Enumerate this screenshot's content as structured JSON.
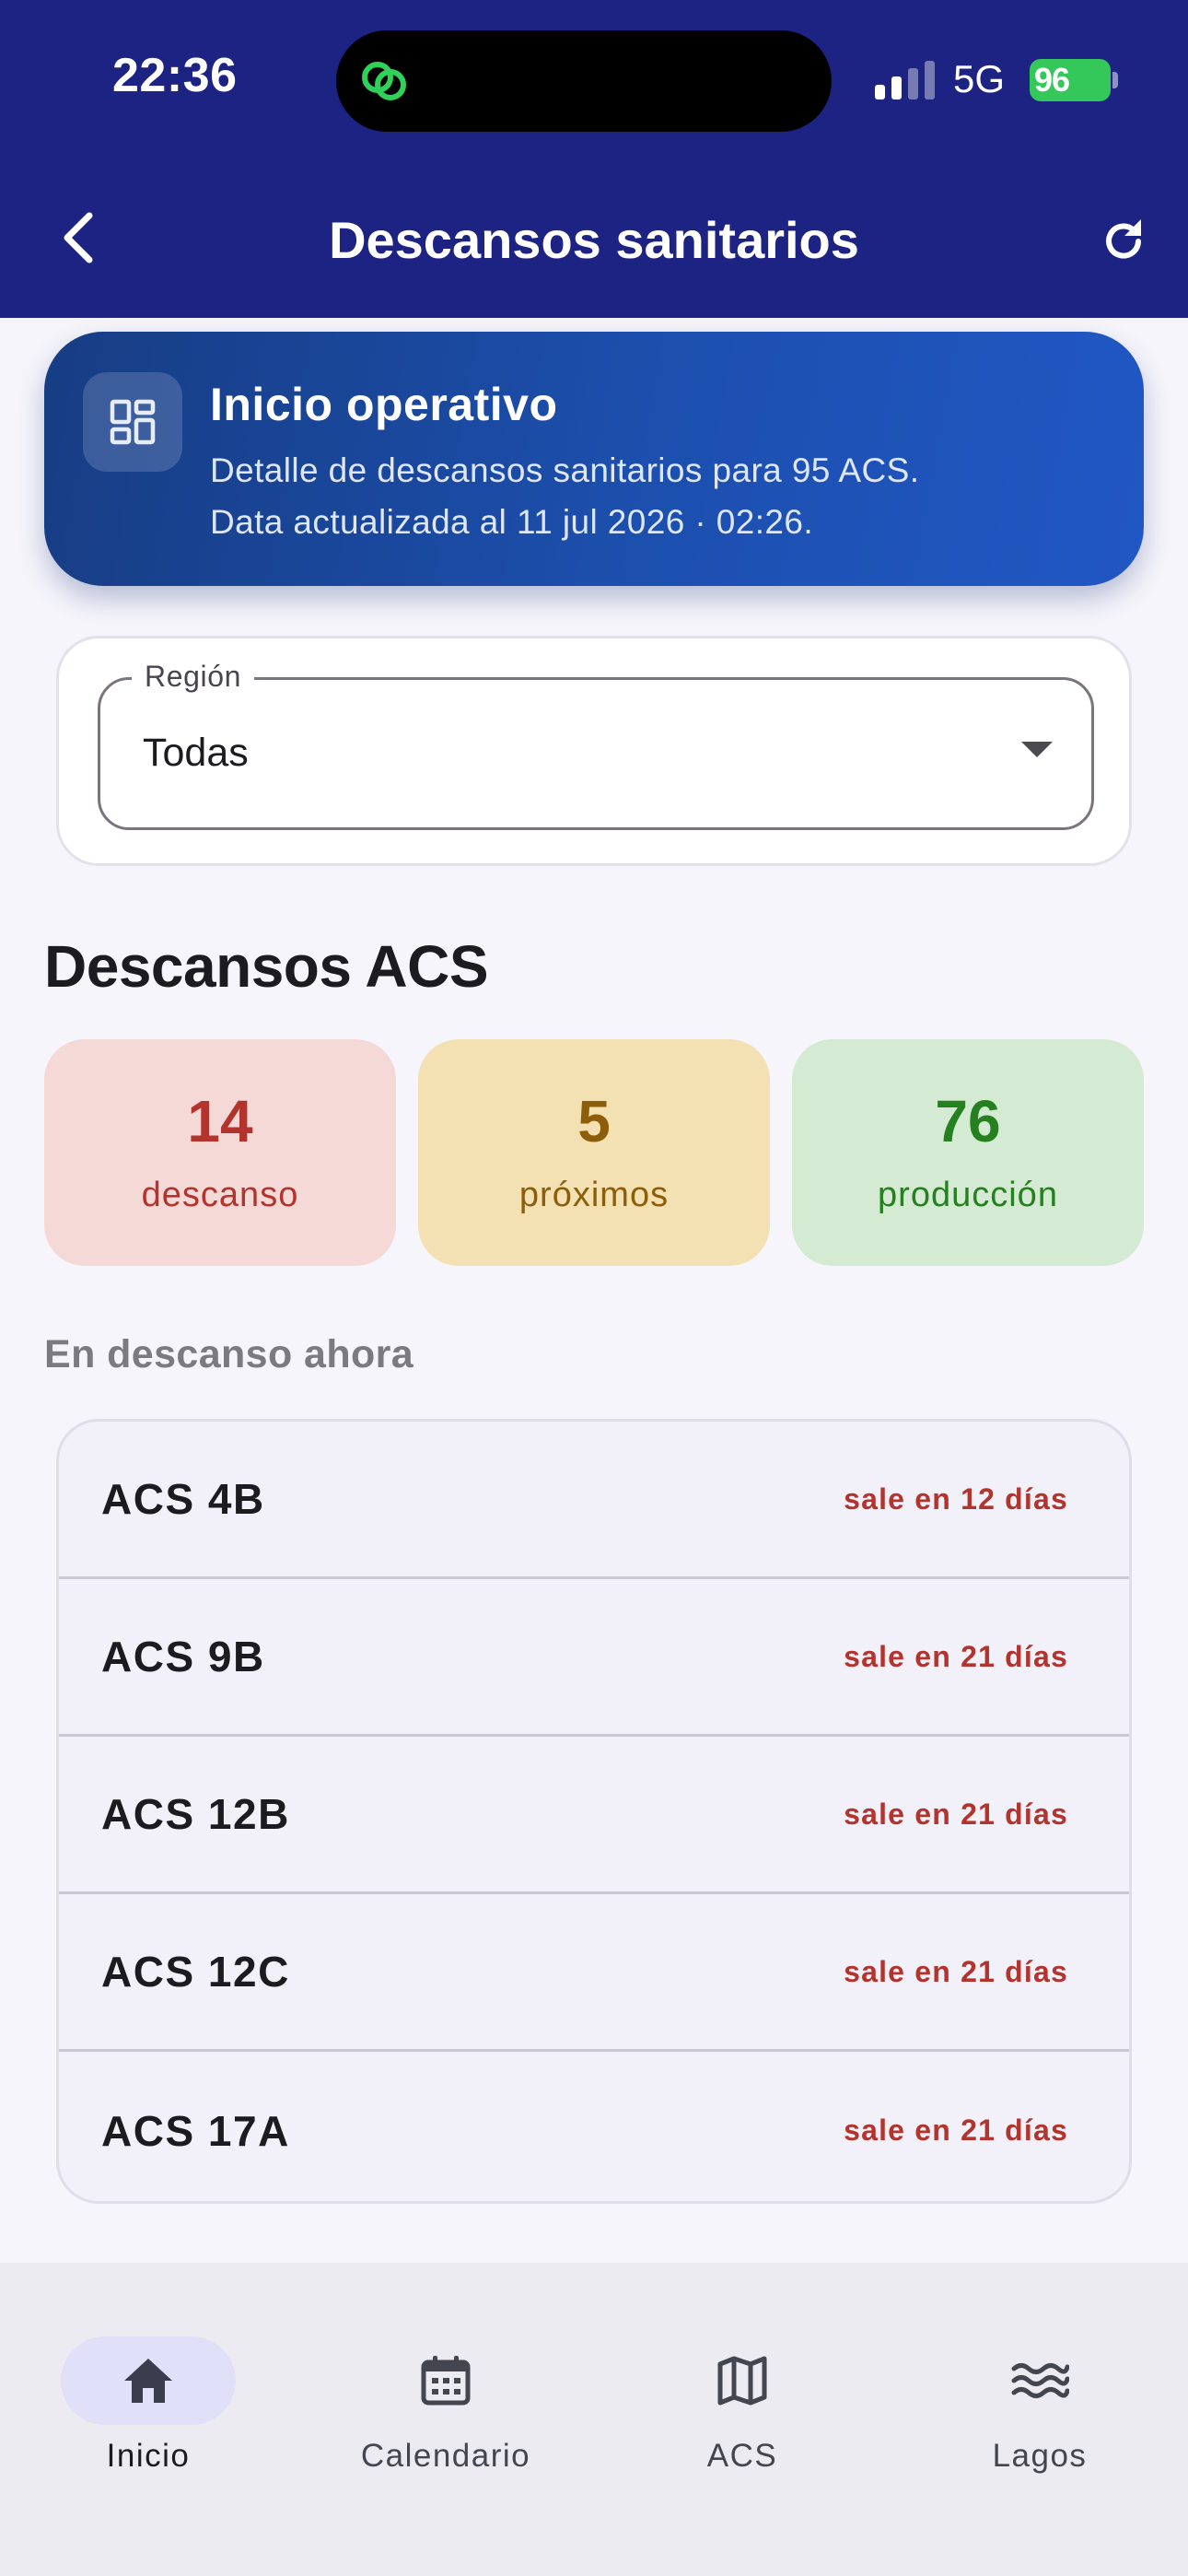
{
  "status_bar": {
    "time": "22:36",
    "network": "5G",
    "battery": "96"
  },
  "app_bar": {
    "title": "Descansos sanitarios",
    "back_icon": "chevron-left-icon",
    "refresh_icon": "refresh-icon"
  },
  "banner": {
    "icon": "dashboard-icon",
    "title": "Inicio operativo",
    "line1": "Detalle de descansos sanitarios para 95 ACS.",
    "line2": "Data actualizada al 11 jul 2026 · 02:26."
  },
  "filter": {
    "label": "Región",
    "value": "Todas"
  },
  "section_title": "Descansos ACS",
  "stats": [
    {
      "value": "14",
      "label": "descanso",
      "color": "#b3332d",
      "bg": "#f5d9d7"
    },
    {
      "value": "5",
      "label": "próximos",
      "color": "#8d5e09",
      "bg": "#f3e0b3"
    },
    {
      "value": "76",
      "label": "producción",
      "color": "#25801f",
      "bg": "#d5ead2"
    }
  ],
  "now_resting": {
    "title": "En descanso ahora",
    "items": [
      {
        "name": "ACS 4B",
        "status": "sale en 12 días"
      },
      {
        "name": "ACS 9B",
        "status": "sale en 21 días"
      },
      {
        "name": "ACS 12B",
        "status": "sale en 21 días"
      },
      {
        "name": "ACS 12C",
        "status": "sale en 21 días"
      },
      {
        "name": "ACS 17A",
        "status": "sale en 21 días"
      }
    ]
  },
  "bottom_nav": [
    {
      "label": "Inicio",
      "icon": "home-icon",
      "active": true
    },
    {
      "label": "Calendario",
      "icon": "calendar-icon",
      "active": false
    },
    {
      "label": "ACS",
      "icon": "map-icon",
      "active": false
    },
    {
      "label": "Lagos",
      "icon": "waves-icon",
      "active": false
    }
  ],
  "colors": {
    "header_bg": "#1c2383",
    "banner_gradient_start": "#173d83",
    "banner_gradient_end": "#2157c4",
    "page_bg": "#f6f5fb",
    "battery_green": "#34c759"
  }
}
